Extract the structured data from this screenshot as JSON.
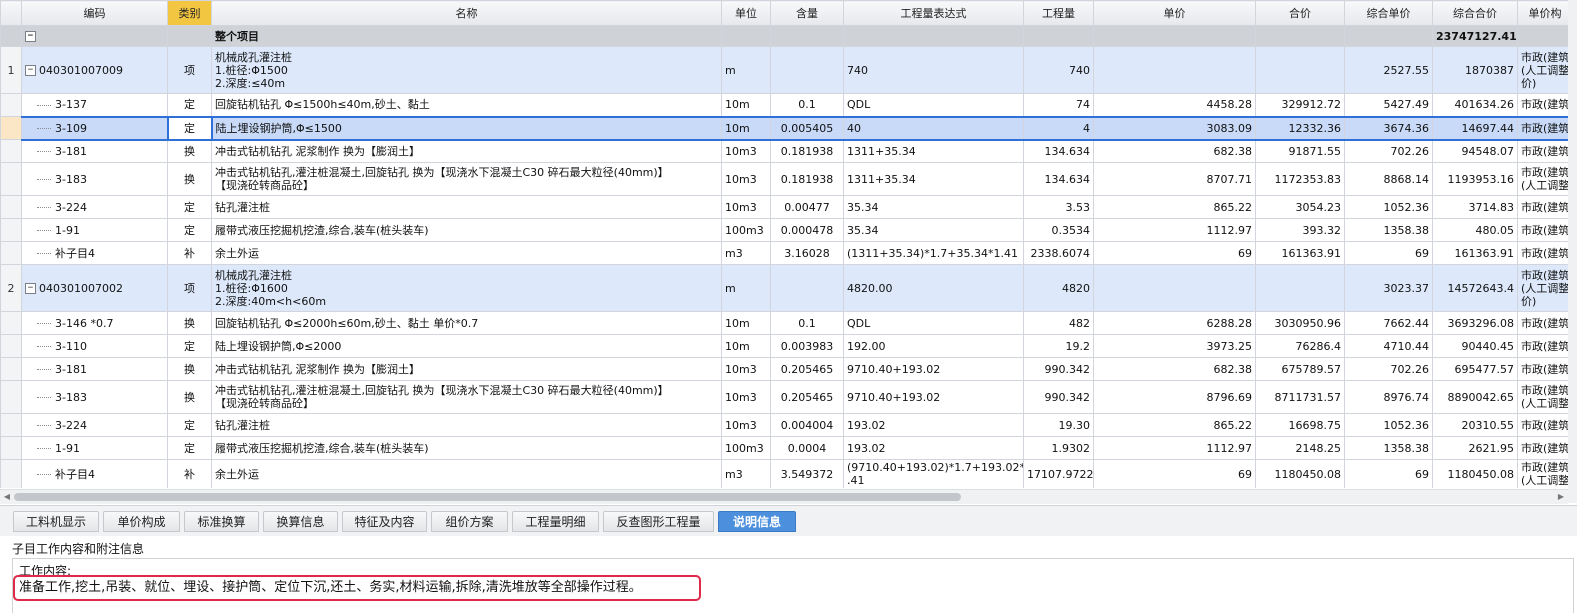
{
  "headers": [
    "",
    "编码",
    "类别",
    "名称",
    "单位",
    "含量",
    "工程量表达式",
    "工程量",
    "单价",
    "合价",
    "综合单价",
    "综合合价",
    "单价构"
  ],
  "total_row": {
    "label": "整个项目",
    "total": "23747127.41"
  },
  "rows": [
    {
      "kind": "bill",
      "num": "1",
      "code": "040301007009",
      "type": "项",
      "name": "机械成孔灌注桩\n1.桩径:Φ1500\n2.深度:≤40m",
      "unit": "m",
      "content": "",
      "expr": "740",
      "qty": "740",
      "price": "",
      "amount": "",
      "cprice": "2527.55",
      "camount": "1870387",
      "cat": "市政(建筑\n(人工调整\n价)"
    },
    {
      "kind": "quota",
      "num": "",
      "code": "3-137",
      "type": "定",
      "name": "回旋钻机钻孔 Φ≤1500h≤40m,砂土、黏土",
      "unit": "10m",
      "content": "0.1",
      "expr": "QDL",
      "qty": "74",
      "price": "4458.28",
      "amount": "329912.72",
      "cprice": "5427.49",
      "camount": "401634.26",
      "cat": "市政(建筑"
    },
    {
      "kind": "sel",
      "num": "",
      "code": "3-109",
      "type": "定",
      "name": "陆上埋设钢护筒,Φ≤1500",
      "unit": "10m",
      "content": "0.005405",
      "expr": "40",
      "qty": "4",
      "price": "3083.09",
      "amount": "12332.36",
      "cprice": "3674.36",
      "camount": "14697.44",
      "cat": "市政(建筑"
    },
    {
      "kind": "quota",
      "num": "",
      "code": "3-181",
      "type": "换",
      "name": "冲击式钻机钻孔 泥浆制作  换为【膨润土】",
      "unit": "10m3",
      "content": "0.181938",
      "expr": "1311+35.34",
      "qty": "134.634",
      "price": "682.38",
      "amount": "91871.55",
      "cprice": "702.26",
      "camount": "94548.07",
      "cat": "市政(建筑"
    },
    {
      "kind": "quota",
      "num": "",
      "code": "3-183",
      "type": "换",
      "name": "冲击式钻机钻孔,灌注桩混凝土,回旋钻孔  换为【现浇水下混凝土C30 碎石最大粒径(40mm)】\n【现浇砼转商品砼】",
      "unit": "10m3",
      "content": "0.181938",
      "expr": "1311+35.34",
      "qty": "134.634",
      "price": "8707.71",
      "amount": "1172353.83",
      "cprice": "8868.14",
      "camount": "1193953.16",
      "cat": "市政(建筑\n(人工调整"
    },
    {
      "kind": "quota",
      "num": "",
      "code": "3-224",
      "type": "定",
      "name": "钻孔灌注桩",
      "unit": "10m3",
      "content": "0.00477",
      "expr": "35.34",
      "qty": "3.53",
      "price": "865.22",
      "amount": "3054.23",
      "cprice": "1052.36",
      "camount": "3714.83",
      "cat": "市政(建筑"
    },
    {
      "kind": "quota",
      "num": "",
      "code": "1-91",
      "type": "定",
      "name": "履带式液压挖掘机挖渣,综合,装车(桩头装车)",
      "unit": "100m3",
      "content": "0.000478",
      "expr": "35.34",
      "qty": "0.3534",
      "price": "1112.97",
      "amount": "393.32",
      "cprice": "1358.38",
      "camount": "480.05",
      "cat": "市政(建筑"
    },
    {
      "kind": "quota",
      "num": "",
      "code": "补子目4",
      "type": "补",
      "name": "余土外运",
      "unit": "m3",
      "content": "3.16028",
      "expr": "(1311+35.34)*1.7+35.34*1.41",
      "qty": "2338.6074",
      "price": "69",
      "amount": "161363.91",
      "cprice": "69",
      "camount": "161363.91",
      "cat": "市政(建筑"
    },
    {
      "kind": "bill",
      "num": "2",
      "code": "040301007002",
      "type": "项",
      "name": "机械成孔灌注桩\n1.桩径:Φ1600\n2.深度:40m<h<60m",
      "unit": "m",
      "content": "",
      "expr": "4820.00",
      "qty": "4820",
      "price": "",
      "amount": "",
      "cprice": "3023.37",
      "camount": "14572643.4",
      "cat": "市政(建筑\n(人工调整\n价)"
    },
    {
      "kind": "quota",
      "num": "",
      "code": "3-146 *0.7",
      "type": "换",
      "name": "回旋钻机钻孔 Φ≤2000h≤60m,砂土、黏土  单价*0.7",
      "unit": "10m",
      "content": "0.1",
      "expr": "QDL",
      "qty": "482",
      "price": "6288.28",
      "amount": "3030950.96",
      "cprice": "7662.44",
      "camount": "3693296.08",
      "cat": "市政(建筑"
    },
    {
      "kind": "quota",
      "num": "",
      "code": "3-110",
      "type": "定",
      "name": "陆上埋设钢护筒,Φ≤2000",
      "unit": "10m",
      "content": "0.003983",
      "expr": "192.00",
      "qty": "19.2",
      "price": "3973.25",
      "amount": "76286.4",
      "cprice": "4710.44",
      "camount": "90440.45",
      "cat": "市政(建筑"
    },
    {
      "kind": "quota",
      "num": "",
      "code": "3-181",
      "type": "换",
      "name": "冲击式钻机钻孔 泥浆制作  换为【膨润土】",
      "unit": "10m3",
      "content": "0.205465",
      "expr": "9710.40+193.02",
      "qty": "990.342",
      "price": "682.38",
      "amount": "675789.57",
      "cprice": "702.26",
      "camount": "695477.57",
      "cat": "市政(建筑"
    },
    {
      "kind": "quota",
      "num": "",
      "code": "3-183",
      "type": "换",
      "name": "冲击式钻机钻孔,灌注桩混凝土,回旋钻孔  换为【现浇水下混凝土C30 碎石最大粒径(40mm)】\n【现浇砼转商品砼】",
      "unit": "10m3",
      "content": "0.205465",
      "expr": "9710.40+193.02",
      "qty": "990.342",
      "price": "8796.69",
      "amount": "8711731.57",
      "cprice": "8976.74",
      "camount": "8890042.65",
      "cat": "市政(建筑\n(人工调整"
    },
    {
      "kind": "quota",
      "num": "",
      "code": "3-224",
      "type": "定",
      "name": "钻孔灌注桩",
      "unit": "10m3",
      "content": "0.004004",
      "expr": "193.02",
      "qty": "19.30",
      "price": "865.22",
      "amount": "16698.75",
      "cprice": "1052.36",
      "camount": "20310.55",
      "cat": "市政(建筑"
    },
    {
      "kind": "quota",
      "num": "",
      "code": "1-91",
      "type": "定",
      "name": "履带式液压挖掘机挖渣,综合,装车(桩头装车)",
      "unit": "100m3",
      "content": "0.0004",
      "expr": "193.02",
      "qty": "1.9302",
      "price": "1112.97",
      "amount": "2148.25",
      "cprice": "1358.38",
      "camount": "2621.95",
      "cat": "市政(建筑"
    },
    {
      "kind": "quota",
      "num": "",
      "code": "补子目4",
      "type": "补",
      "name": "余土外运",
      "unit": "m3",
      "content": "3.549372",
      "expr": "(9710.40+193.02)*1.7+193.02*1\n.41",
      "qty": "17107.9722",
      "price": "69",
      "amount": "1180450.08",
      "cprice": "69",
      "camount": "1180450.08",
      "cat": "市政(建筑\n(人工调整"
    }
  ],
  "tabs": [
    "工料机显示",
    "单价构成",
    "标准换算",
    "换算信息",
    "特征及内容",
    "组价方案",
    "工程量明细",
    "反查图形工程量",
    "说明信息"
  ],
  "active_tab": 8,
  "detail": {
    "title": "子目工作内容和附注信息",
    "label": "工作内容:",
    "text": "准备工作,挖土,吊装、就位、埋设、接护筒、定位下沉,还土、务实,材料运输,拆除,清洗堆放等全部操作过程。"
  }
}
